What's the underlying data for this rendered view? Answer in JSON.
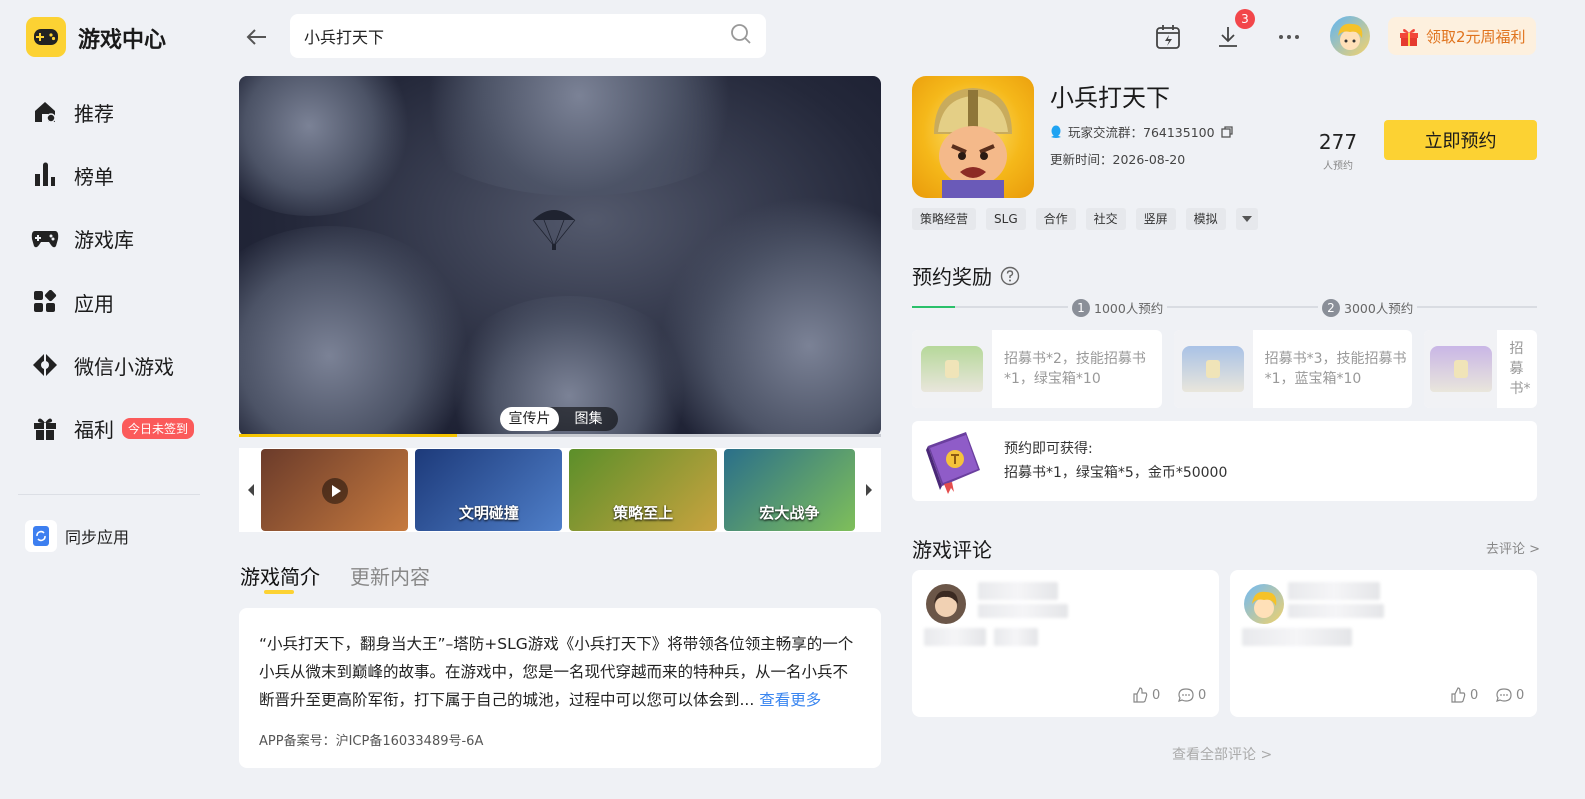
{
  "app": {
    "title": "游戏中心"
  },
  "sidebar": {
    "items": [
      {
        "label": "推荐",
        "icon": "home-icon"
      },
      {
        "label": "榜单",
        "icon": "chart-icon"
      },
      {
        "label": "游戏库",
        "icon": "gamepad-icon"
      },
      {
        "label": "应用",
        "icon": "apps-icon"
      },
      {
        "label": "微信小游戏",
        "icon": "wechat-game-icon"
      },
      {
        "label": "福利",
        "icon": "gift-icon",
        "badge": "今日未签到"
      }
    ],
    "sync_label": "同步应用"
  },
  "header": {
    "search_value": "小兵打天下",
    "download_badge": "3",
    "promo_label": "领取2元周福利"
  },
  "media": {
    "tabs": [
      "宣传片",
      "图集"
    ],
    "thumbnails": [
      {
        "caption": "",
        "colors": [
          "#6b3b2a",
          "#c67a3f"
        ]
      },
      {
        "caption": "文明碰撞",
        "colors": [
          "#1d3a7a",
          "#4f7fc9"
        ]
      },
      {
        "caption": "策略至上",
        "colors": [
          "#5b8f2a",
          "#c9a33f"
        ]
      },
      {
        "caption": "宏大战争",
        "colors": [
          "#2a6f8a",
          "#7fbf5a"
        ]
      }
    ]
  },
  "content_tabs": [
    "游戏简介",
    "更新内容"
  ],
  "description": {
    "text": "“小兵打天下，翻身当大王”–塔防+SLG游戏《小兵打天下》将带领各位领主畅享的一个小兵从微末到巅峰的故事。在游戏中，您是一名现代穿越而来的特种兵，从一名小兵不断晋升至更高阶军衔，打下属于自己的城池，过程中可以您可以体会到...",
    "more": "查看更多",
    "icp": "APP备案号：沪ICP备16033489号-6A"
  },
  "game": {
    "name": "小兵打天下",
    "group_label": "玩家交流群：764135100",
    "update_label": "更新时间：2026-08-20",
    "reserve_count": "277",
    "reserve_count_label": "人预约",
    "reserve_button": "立即预约",
    "tags": [
      "策略经营",
      "SLG",
      "合作",
      "社交",
      "竖屏",
      "模拟"
    ]
  },
  "rewards": {
    "title": "预约奖励",
    "milestones": [
      {
        "num": "1",
        "label": "1000人预约"
      },
      {
        "num": "2",
        "label": "3000人预约"
      }
    ],
    "cards": [
      {
        "text": "招募书*2，技能招募书*1，绿宝箱*10",
        "color": "#b6d89a"
      },
      {
        "text": "招募书*3，技能招募书*1，蓝宝箱*10",
        "color": "#a9c2e6"
      },
      {
        "text": "招募书*",
        "color": "#c9b6e6"
      }
    ],
    "preorder_title": "预约即可获得:",
    "preorder_items": "招募书*1，绿宝箱*5，金币*50000"
  },
  "reviews": {
    "title": "游戏评论",
    "link": "去评论 >",
    "cards": [
      {
        "likes": "0",
        "comments": "0"
      },
      {
        "likes": "0",
        "comments": "0"
      }
    ],
    "view_all": "查看全部评论 >"
  }
}
